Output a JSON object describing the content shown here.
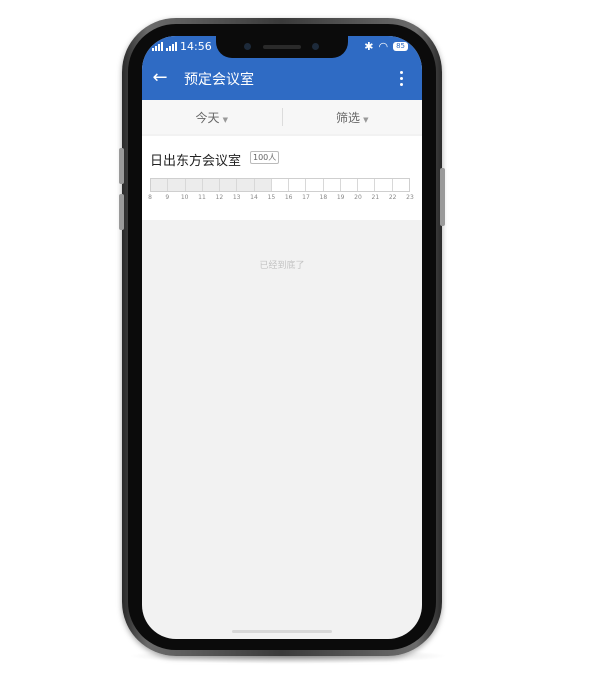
{
  "status_bar": {
    "time": "14:56",
    "battery": "85"
  },
  "app_bar": {
    "title": "预定会议室"
  },
  "filters": {
    "date_label": "今天",
    "filter_label": "筛选"
  },
  "room": {
    "name": "日出东方会议室",
    "capacity": "100人",
    "hours": [
      "8",
      "9",
      "10",
      "11",
      "12",
      "13",
      "14",
      "15",
      "16",
      "17",
      "18",
      "19",
      "20",
      "21",
      "22",
      "23"
    ],
    "past_slot_count": 7
  },
  "list_end_text": "已经到底了",
  "colors": {
    "primary": "#2f6bc4",
    "background": "#f2f2f2"
  }
}
